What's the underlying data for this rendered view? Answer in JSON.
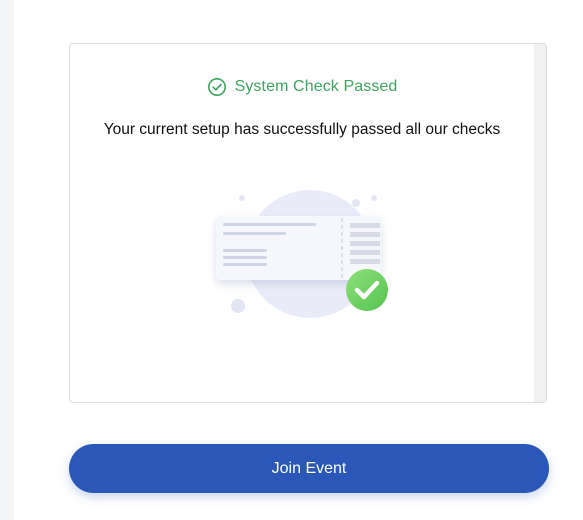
{
  "check": {
    "status_icon": "check-circle-icon",
    "status_text": "System Check Passed",
    "status_color": "#3fa45f",
    "message": "Your current setup has successfully passed all our checks"
  },
  "illustration": {
    "name": "ticket-check-illustration"
  },
  "actions": {
    "join_label": "Join Event",
    "join_color": "#2a57b8"
  }
}
